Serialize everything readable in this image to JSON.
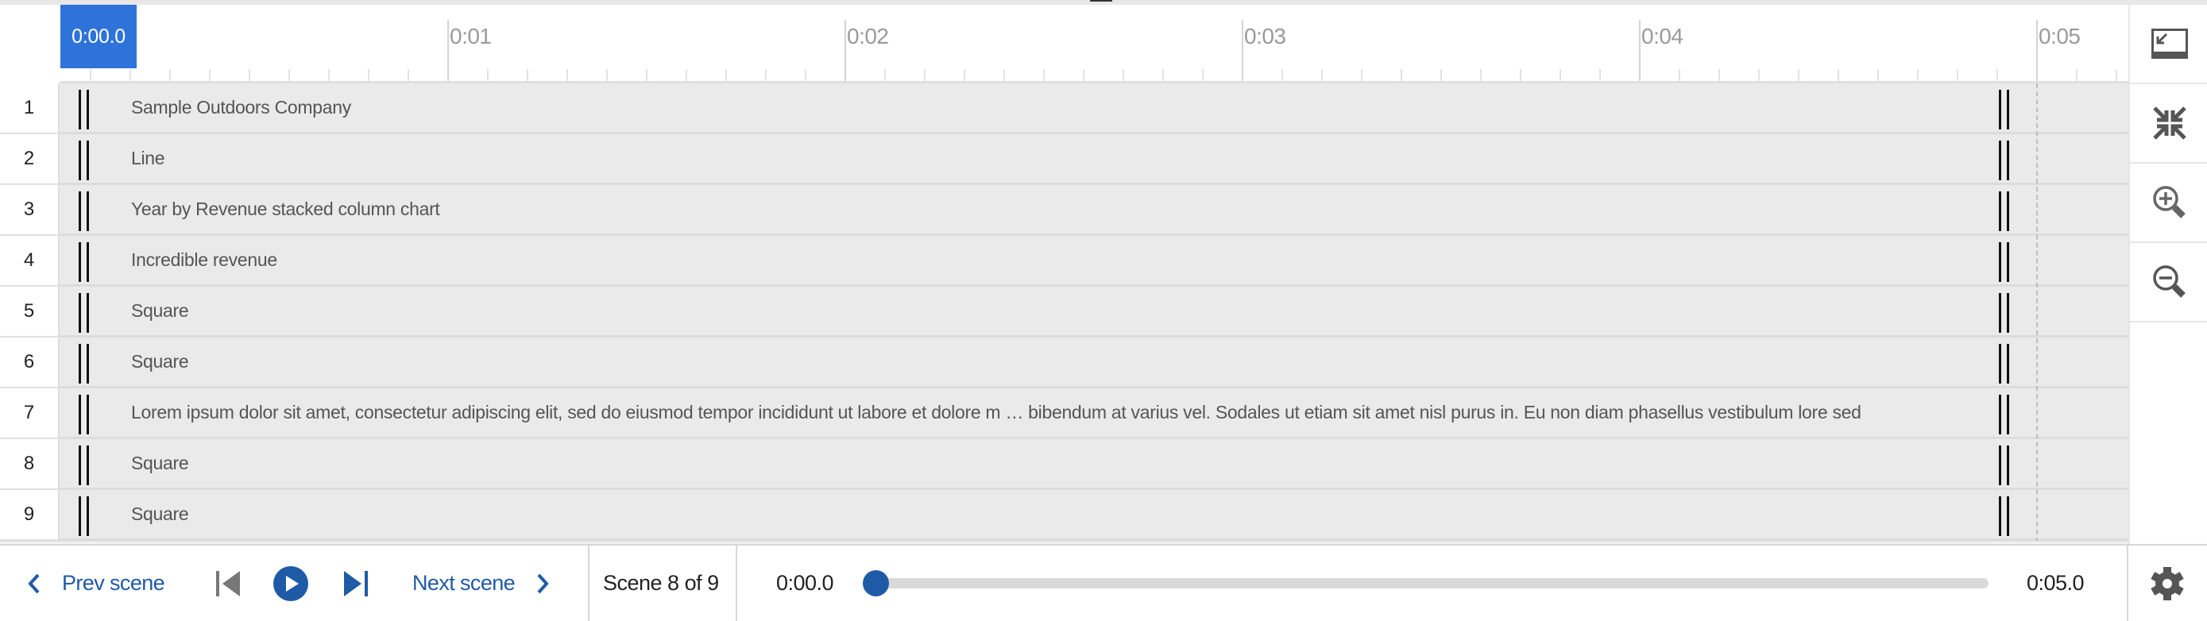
{
  "ruler": {
    "playhead_label": "0:00.0",
    "major_labels": [
      "0:01",
      "0:02",
      "0:03",
      "0:04",
      "0:05"
    ],
    "duration_seconds": 5
  },
  "rows": [
    {
      "num": "1",
      "label": "Sample Outdoors Company"
    },
    {
      "num": "2",
      "label": "Line"
    },
    {
      "num": "3",
      "label": "Year by Revenue stacked column chart"
    },
    {
      "num": "4",
      "label": "Incredible revenue"
    },
    {
      "num": "5",
      "label": "Square"
    },
    {
      "num": "6",
      "label": "Square"
    },
    {
      "num": "7",
      "label": "Lorem ipsum dolor sit amet, consectetur adipiscing elit, sed do eiusmod tempor incididunt ut labore et dolore m … bibendum at varius vel. Sodales ut etiam sit amet nisl purus in. Eu non diam phasellus vestibulum lore sed"
    },
    {
      "num": "8",
      "label": "Square"
    },
    {
      "num": "9",
      "label": "Square"
    }
  ],
  "right_panel": {
    "buttons": [
      {
        "icon": "dock-minimize-icon"
      },
      {
        "icon": "collapse-icon"
      },
      {
        "icon": "zoom-in-icon"
      },
      {
        "icon": "zoom-out-icon"
      }
    ]
  },
  "bottom_bar": {
    "prev_scene": "Prev scene",
    "next_scene": "Next scene",
    "scene_indicator": "Scene 8 of 9",
    "current_time": "0:00.0",
    "end_time": "0:05.0",
    "progress_fraction": 0.0
  },
  "colors": {
    "accent": "#1f5aa6",
    "playhead": "#2e73d9",
    "row_bg": "#eaeaea",
    "disabled_icon": "#777777"
  }
}
